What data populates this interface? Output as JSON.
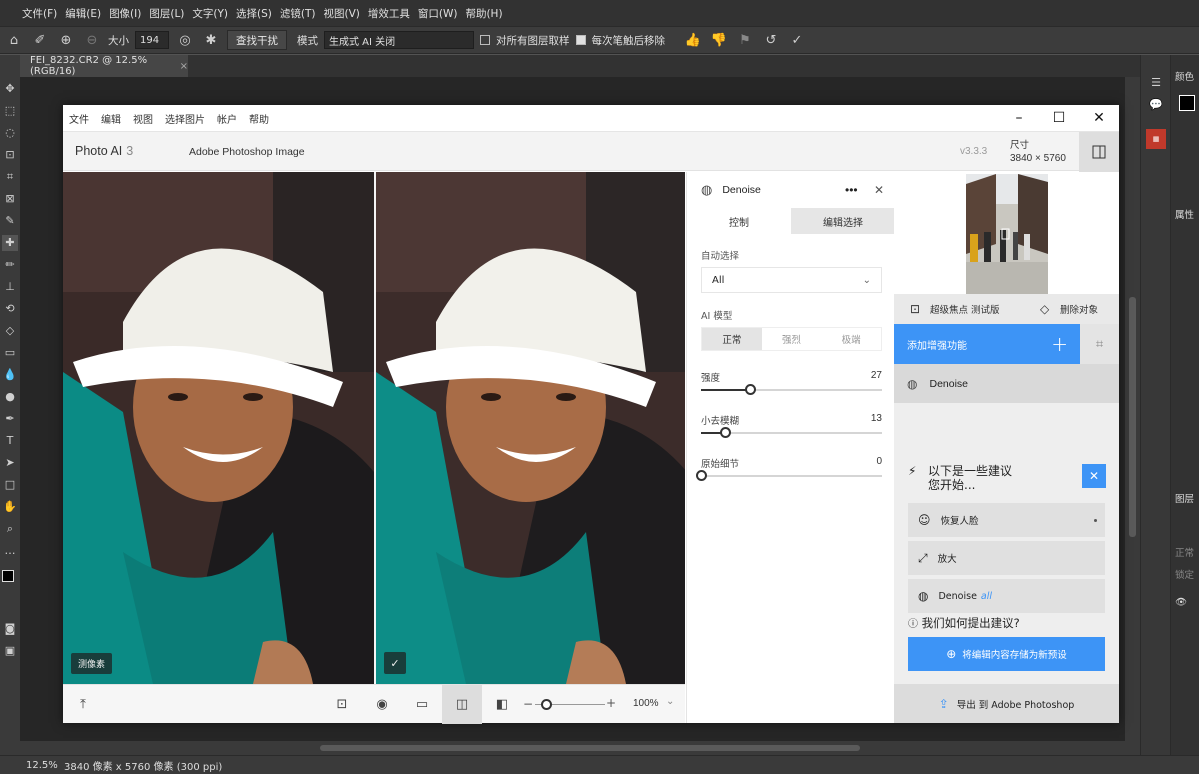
{
  "ps": {
    "menu": [
      "文件(F)",
      "编辑(E)",
      "图像(I)",
      "图层(L)",
      "文字(Y)",
      "选择(S)",
      "滤镜(T)",
      "视图(V)",
      "增效工具",
      "窗口(W)",
      "帮助(H)"
    ],
    "options": {
      "size_label": "大小",
      "size_value": "194",
      "find_noise_btn": "查找干扰",
      "mode_label": "模式",
      "mode_value": "生成式 AI 关闭",
      "all_layers_label": "对所有图层取样",
      "remove_after_label": "每次笔触后移除"
    },
    "tab_title": "FEI_8232.CR2 @ 12.5%(RGB/16)",
    "status_zoom": "12.5%",
    "status_info": "3840 像素 x 5760 像素 (300 ppi)",
    "right_panels": {
      "color": "颜色",
      "properties": "属性",
      "layers": "图层",
      "blend": "正常",
      "lock": "锁定"
    }
  },
  "pa": {
    "menu": [
      "文件",
      "编辑",
      "视图",
      "选择图片",
      "帐户",
      "帮助"
    ],
    "brand": "Photo AI",
    "brand_ver": "3",
    "doc_title": "Adobe Photoshop Image",
    "version": "v3.3.3",
    "size_label": "尺寸",
    "size_value": "3840 × 5760",
    "left_badge": "测像素",
    "zoom": "100%",
    "panel": {
      "title": "Denoise",
      "tabs": [
        "控制",
        "编辑选择"
      ],
      "auto_select_label": "自动选择",
      "auto_select_value": "All",
      "ai_model_label": "AI 模型",
      "models": [
        "正常",
        "强烈",
        "极端"
      ],
      "sliders": [
        {
          "label": "强度",
          "value": 27
        },
        {
          "label": "小去模糊",
          "value": 13
        },
        {
          "label": "原始细节",
          "value": 0
        }
      ]
    },
    "right": {
      "focus_tool": "超级焦点 测试版",
      "remove_tool": "删除对象",
      "add_enhance": "添加增强功能",
      "layer": "Denoise",
      "sugg_title_1": "以下是一些建议",
      "sugg_title_2": "您开始...",
      "suggestions": [
        {
          "label": "恢复人脸",
          "tag": ""
        },
        {
          "label": "放大",
          "tag": ""
        },
        {
          "label": "Denoise",
          "tag": "all"
        }
      ],
      "how": "我们如何提出建议?",
      "save_preset": "将编辑内容存储为新预设",
      "export": "导出 到 Adobe Photoshop"
    }
  },
  "colors": {
    "accent": "#3d94f6",
    "ps_bg": "#535353"
  }
}
